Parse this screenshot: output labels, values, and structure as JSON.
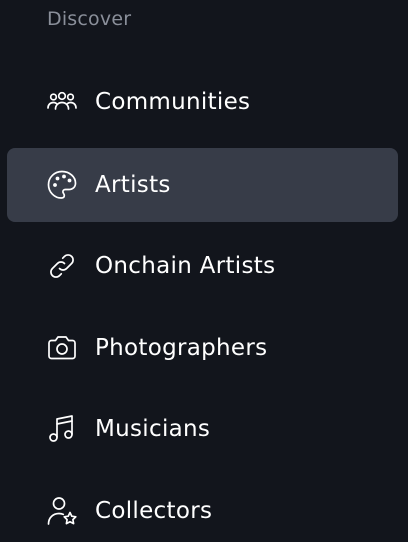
{
  "section": {
    "heading": "Discover"
  },
  "nav": {
    "items": [
      {
        "label": "Communities",
        "icon": "users-group-icon",
        "active": false
      },
      {
        "label": "Artists",
        "icon": "palette-icon",
        "active": true
      },
      {
        "label": "Onchain Artists",
        "icon": "link-icon",
        "active": false
      },
      {
        "label": "Photographers",
        "icon": "camera-icon",
        "active": false
      },
      {
        "label": "Musicians",
        "icon": "music-note-icon",
        "active": false
      },
      {
        "label": "Collectors",
        "icon": "user-star-icon",
        "active": false
      }
    ]
  },
  "colors": {
    "background": "#12151c",
    "active_background": "#373c48",
    "heading_text": "#8a8f9a",
    "text": "#ffffff"
  }
}
